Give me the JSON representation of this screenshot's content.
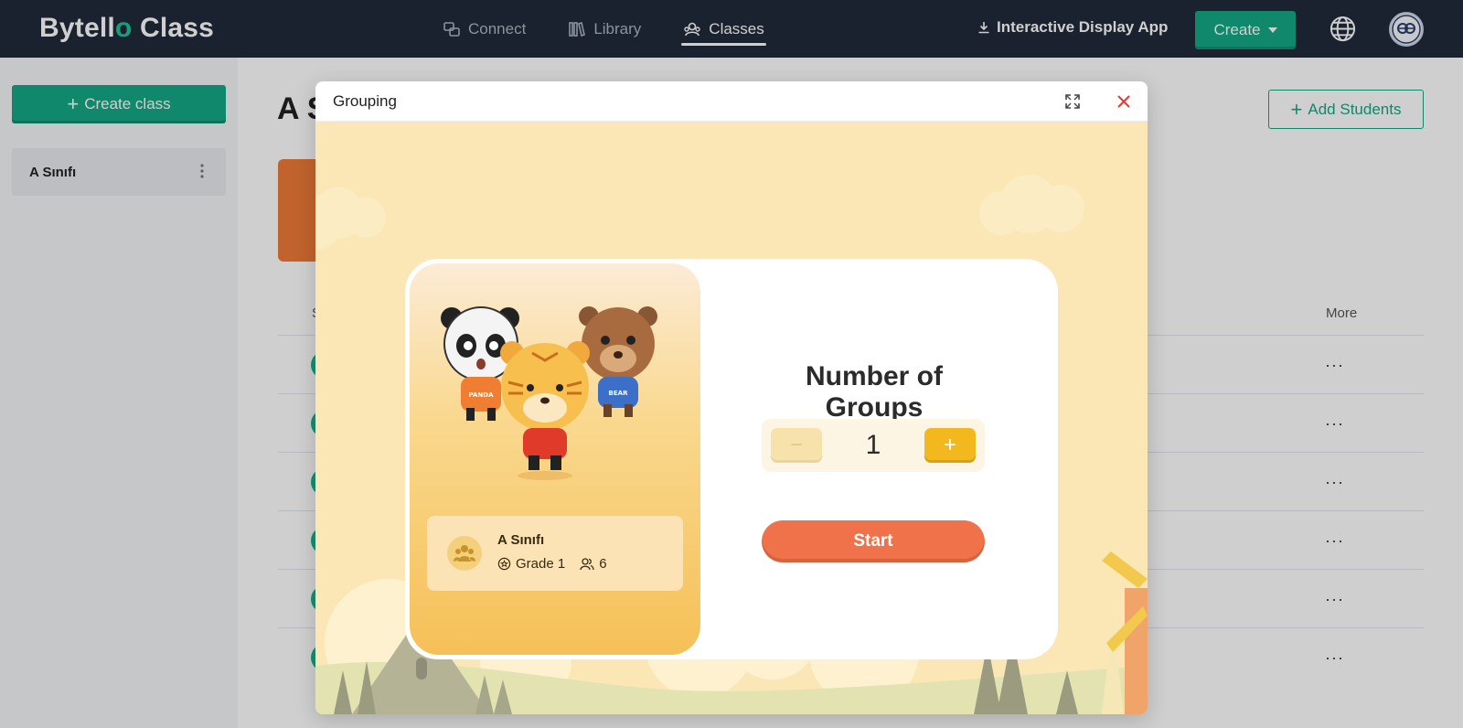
{
  "topbar": {
    "logo_text": "Bytell",
    "logo_dot": "o",
    "logo_suffix": " Class",
    "nav": [
      {
        "label": "Connect",
        "icon": "connect-icon",
        "active": false
      },
      {
        "label": "Library",
        "icon": "library-icon",
        "active": false
      },
      {
        "label": "Classes",
        "icon": "classes-icon",
        "active": true
      }
    ],
    "download_app_label": "Interactive Display App",
    "create_label": "Create"
  },
  "sidebar": {
    "create_class_label": "Create class",
    "items": [
      {
        "label": "A Sınıfı"
      }
    ]
  },
  "main": {
    "title": "A S",
    "add_students_label": "Add Students",
    "header_first": "S",
    "header_more": "More",
    "rows": [
      {
        "more": "···"
      },
      {
        "more": "···"
      },
      {
        "more": "···"
      },
      {
        "more": "···"
      },
      {
        "more": "···"
      },
      {
        "more": "···"
      }
    ]
  },
  "modal": {
    "title": "Grouping",
    "class_card": {
      "name": "A Sınıfı",
      "grade": "Grade 1",
      "student_count": "6"
    },
    "number_of_groups_label": "Number of Groups",
    "stepper": {
      "minus_label": "−",
      "value": "1",
      "plus_label": "+"
    },
    "start_label": "Start",
    "mascot_shirt_labels": [
      "PANDA",
      "BEAR"
    ]
  },
  "colors": {
    "topbar_bg": "#20293a",
    "brand_green": "#13a884",
    "modal_bg": "#fbe7b6",
    "start_orange": "#ef724a",
    "plus_yellow": "#f2b81e"
  }
}
